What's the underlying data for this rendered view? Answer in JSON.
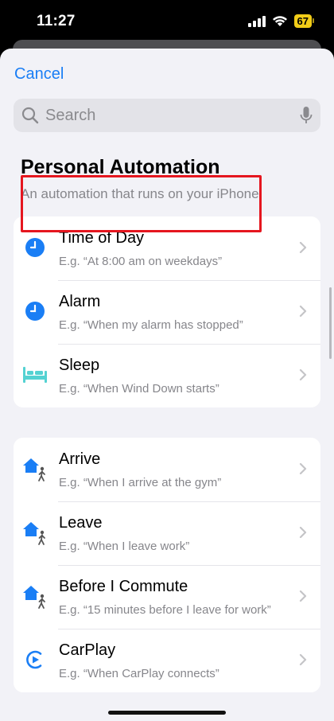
{
  "status_bar": {
    "time": "11:27",
    "battery": "67",
    "icons": [
      "cellular-signal-icon",
      "wifi-icon",
      "battery-icon"
    ]
  },
  "header": {
    "cancel_label": "Cancel"
  },
  "search": {
    "placeholder": "Search",
    "icons": [
      "search-icon",
      "microphone-icon"
    ]
  },
  "section": {
    "title": "Personal Automation",
    "subtitle": "An automation that runs on your iPhone."
  },
  "groups": [
    {
      "items": [
        {
          "icon": "clock-icon",
          "title": "Time of Day",
          "subtitle": "E.g. “At 8:00 am on weekdays”",
          "highlighted": true
        },
        {
          "icon": "clock-icon",
          "title": "Alarm",
          "subtitle": "E.g. “When my alarm has stopped”"
        },
        {
          "icon": "bed-icon",
          "title": "Sleep",
          "subtitle": "E.g. “When Wind Down starts”"
        }
      ]
    },
    {
      "items": [
        {
          "icon": "home-walk-icon",
          "title": "Arrive",
          "subtitle": "E.g. “When I arrive at the gym”"
        },
        {
          "icon": "home-walk-icon",
          "title": "Leave",
          "subtitle": "E.g. “When I leave work”"
        },
        {
          "icon": "home-walk-icon",
          "title": "Before I Commute",
          "subtitle": "E.g. “15 minutes before I leave for work”"
        },
        {
          "icon": "carplay-icon",
          "title": "CarPlay",
          "subtitle": "E.g. “When CarPlay connects”"
        }
      ]
    }
  ],
  "colors": {
    "accent": "#1a7ef5",
    "icon_blue": "#1a7ef5",
    "sleep_teal": "#54d2d2",
    "highlight_red": "#e5161f",
    "background": "#f2f2f7"
  }
}
